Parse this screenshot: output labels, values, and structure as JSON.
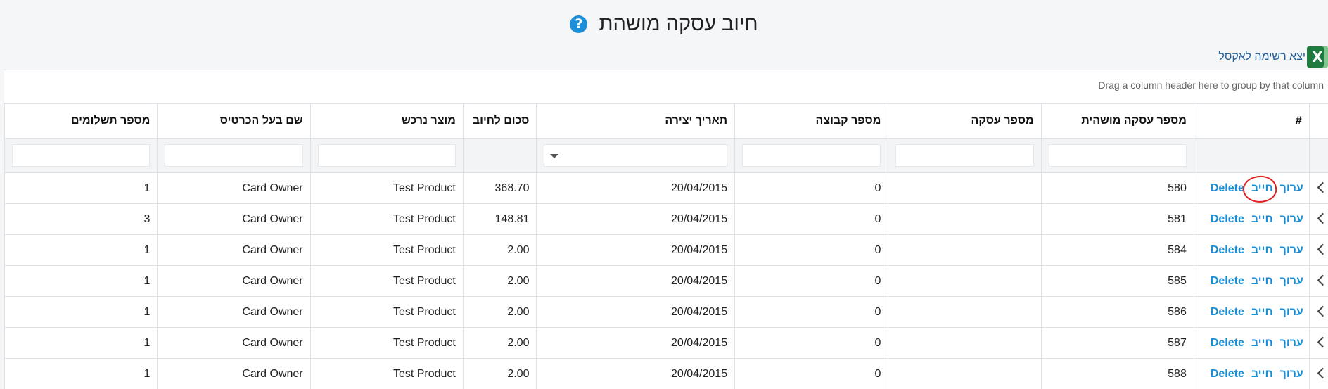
{
  "header": {
    "title": "חיוב עסקה מושהת",
    "help_icon": "question-circle-icon"
  },
  "export": {
    "label": "יצא רשימה לאקסל",
    "icon": "excel-icon",
    "icon_glyph": "X"
  },
  "grid": {
    "group_hint": "Drag a column header here to group by that column",
    "columns": {
      "hash": "#",
      "suspended_id": "מספר עסקה מושהית",
      "deal_id": "מספר עסקה",
      "group_id": "מספר קבוצה",
      "created": "תאריך יצירה",
      "amount": "סכום לחיוב",
      "product": "מוצר נרכש",
      "card_owner": "שם בעל הכרטיס",
      "payments": "מספר תשלומים"
    },
    "actions": {
      "edit": "ערוך",
      "charge": "חייב",
      "delete": "Delete"
    },
    "rows": [
      {
        "id": "580",
        "deal": "",
        "group": "0",
        "created": "20/04/2015",
        "amount": "368.70",
        "product": "Test Product",
        "owner": "Card Owner",
        "payments": "1"
      },
      {
        "id": "581",
        "deal": "",
        "group": "0",
        "created": "20/04/2015",
        "amount": "148.81",
        "product": "Test Product",
        "owner": "Card Owner",
        "payments": "3"
      },
      {
        "id": "584",
        "deal": "",
        "group": "0",
        "created": "20/04/2015",
        "amount": "2.00",
        "product": "Test Product",
        "owner": "Card Owner",
        "payments": "1"
      },
      {
        "id": "585",
        "deal": "",
        "group": "0",
        "created": "20/04/2015",
        "amount": "2.00",
        "product": "Test Product",
        "owner": "Card Owner",
        "payments": "1"
      },
      {
        "id": "586",
        "deal": "",
        "group": "0",
        "created": "20/04/2015",
        "amount": "2.00",
        "product": "Test Product",
        "owner": "Card Owner",
        "payments": "1"
      },
      {
        "id": "587",
        "deal": "",
        "group": "0",
        "created": "20/04/2015",
        "amount": "2.00",
        "product": "Test Product",
        "owner": "Card Owner",
        "payments": "1"
      },
      {
        "id": "588",
        "deal": "",
        "group": "0",
        "created": "20/04/2015",
        "amount": "2.00",
        "product": "Test Product",
        "owner": "Card Owner",
        "payments": "1"
      }
    ]
  }
}
